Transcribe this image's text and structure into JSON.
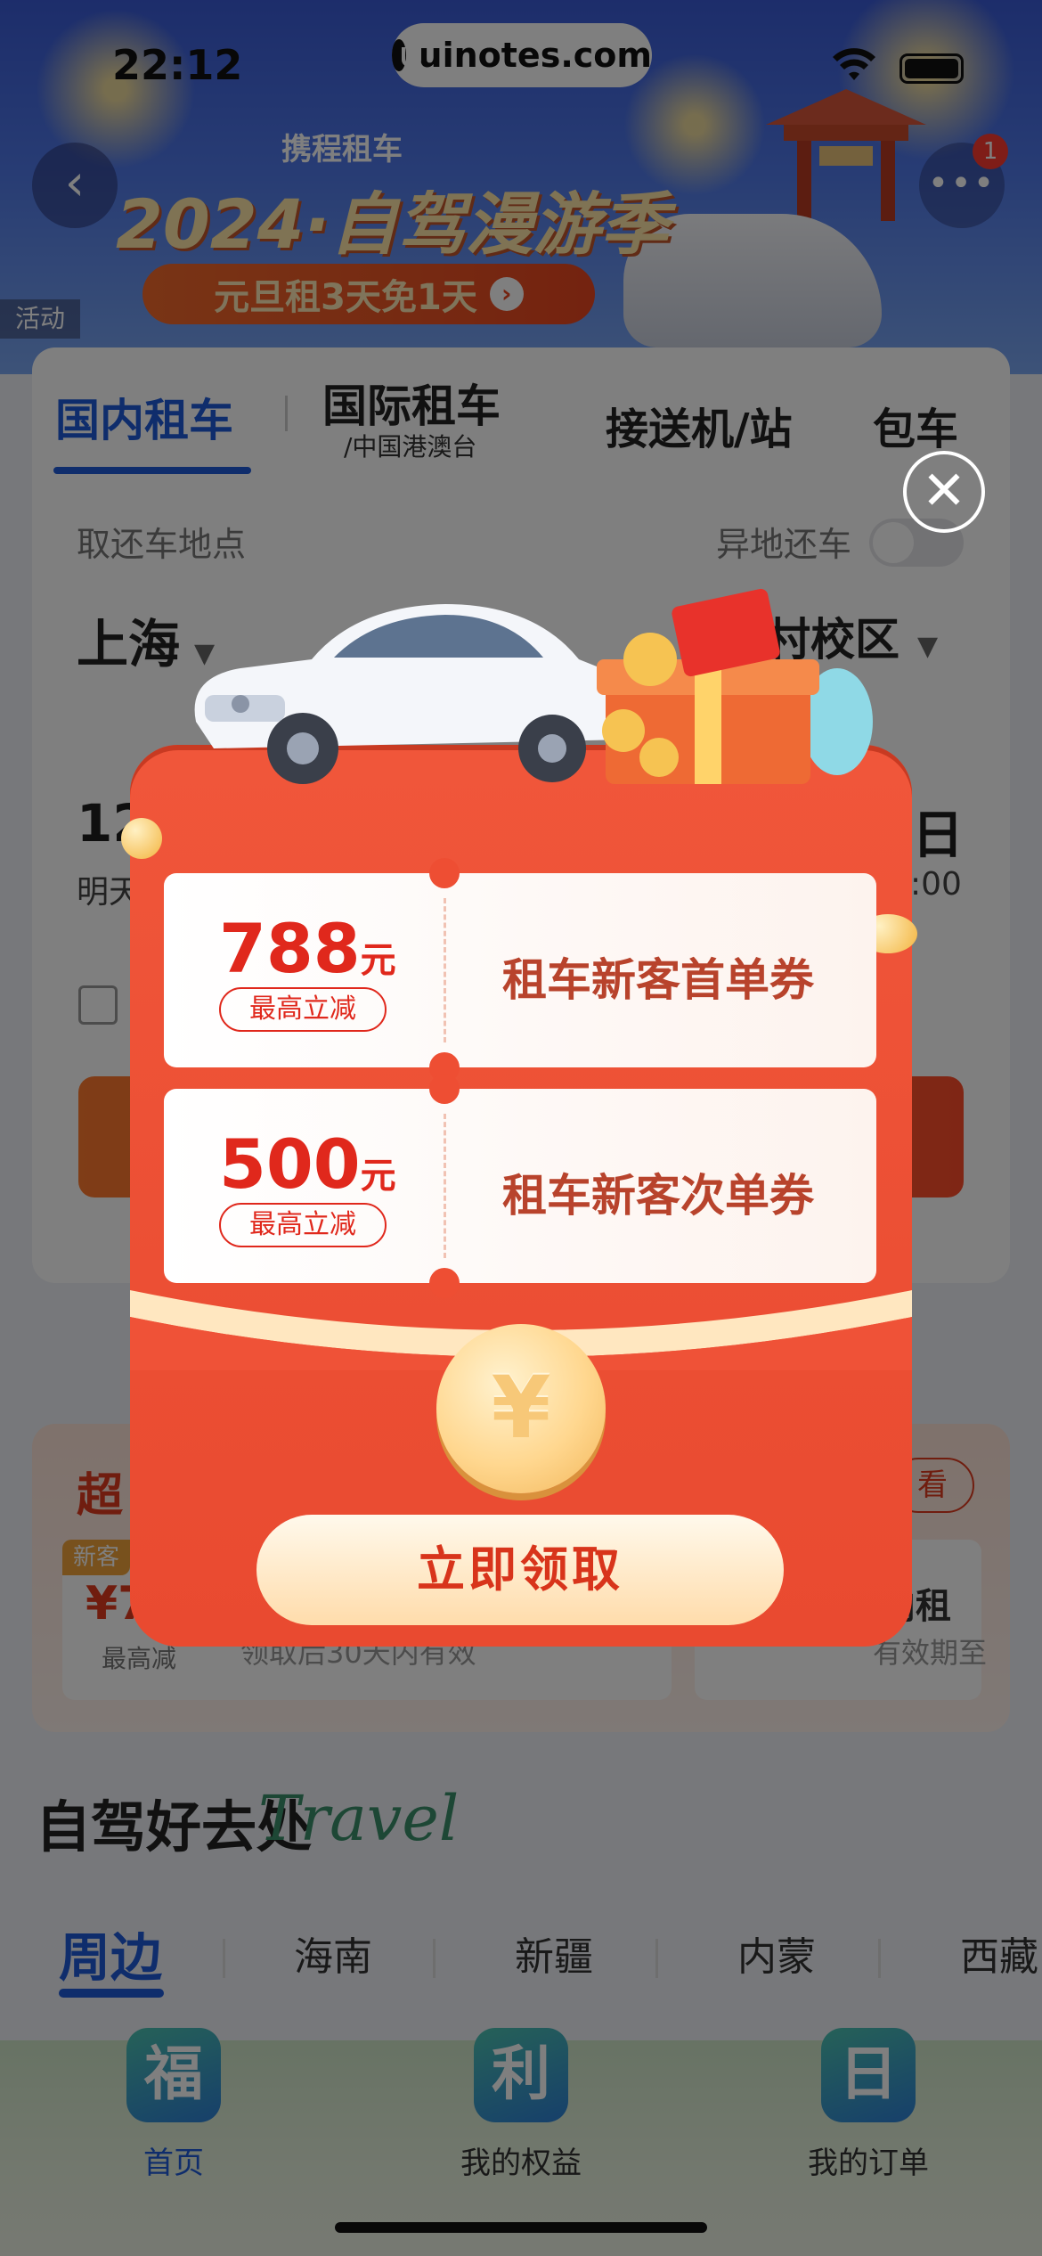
{
  "status_bar": {
    "time": "22:12",
    "site": "uinotes.com"
  },
  "banner": {
    "brand": "携程租车",
    "title": "2024·自驾漫游季",
    "promo": "元旦租3天免1天",
    "activity_tag": "活动",
    "more_badge": "1"
  },
  "tabs": [
    {
      "label": "国内租车"
    },
    {
      "label": "国际租车",
      "sub": "/中国港澳台"
    },
    {
      "label": "接送机/站"
    },
    {
      "label": "包车"
    }
  ],
  "booking": {
    "pickup_label": "取还车地点",
    "other_return_label": "异地还车",
    "city": "上海",
    "destination": "村校区",
    "start_date": "12",
    "start_sub": "明天",
    "end_date": "日",
    "end_sub": ":00"
  },
  "super_section": {
    "title": "超",
    "view_more": "看",
    "left_coupon": {
      "new_tag": "新客",
      "price": "¥7",
      "cap": "最高减",
      "valid": "领取后30天内有效"
    },
    "right_coupon": {
      "title": "内租",
      "valid": "有效期至"
    }
  },
  "destinations": {
    "title": "自驾好去处",
    "deco": "Travel",
    "regions": [
      "周边",
      "海南",
      "新疆",
      "内蒙",
      "西藏"
    ]
  },
  "bottom_nav": [
    {
      "icon_char": "福",
      "label": "首页"
    },
    {
      "icon_char": "利",
      "label": "我的权益"
    },
    {
      "icon_char": "日",
      "label": "我的订单"
    }
  ],
  "popup": {
    "coupons": [
      {
        "amount": "788",
        "unit": "元",
        "cap": "最高立减",
        "name": "租车新客首单券"
      },
      {
        "amount": "500",
        "unit": "元",
        "cap": "最高立减",
        "name": "租车新客次单券"
      }
    ],
    "coin_symbol": "¥",
    "claim_label": "立即领取",
    "close_symbol": "✕"
  }
}
